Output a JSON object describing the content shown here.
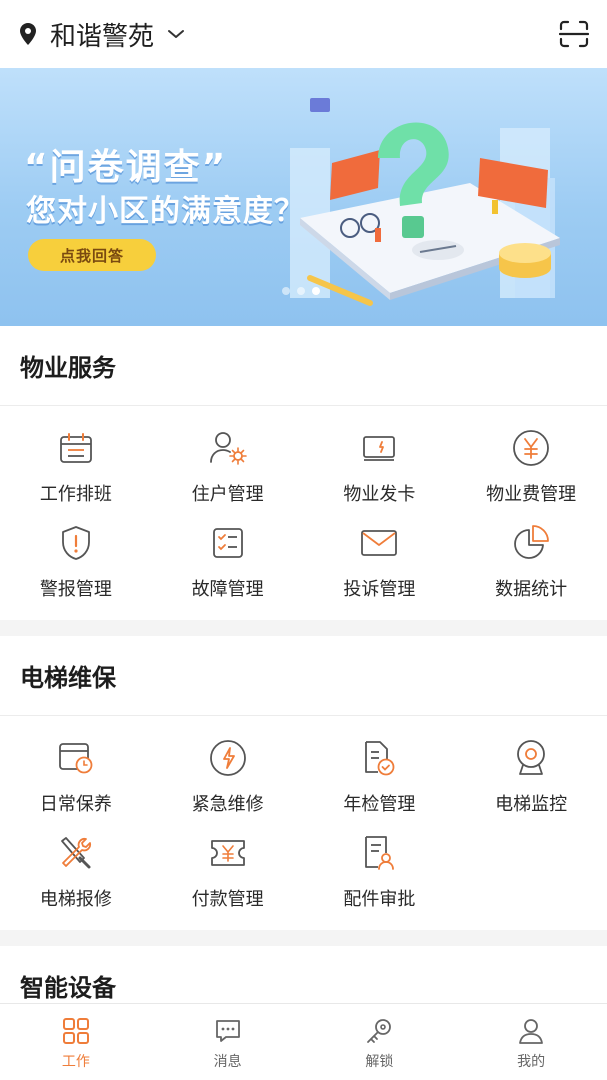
{
  "header": {
    "location": "和谐警苑",
    "location_icon": "map-pin-icon",
    "dropdown_icon": "chevron-down-icon",
    "scan_icon": "scan-icon"
  },
  "banner": {
    "title": "“问卷调查”",
    "subtitle": "您对小区的满意度？",
    "button": "点我回答",
    "dots": [
      false,
      false,
      true
    ]
  },
  "sections": [
    {
      "title": "物业服务",
      "items": [
        {
          "label": "工作排班",
          "icon": "calendar-icon"
        },
        {
          "label": "住户管理",
          "icon": "user-settings-icon"
        },
        {
          "label": "物业发卡",
          "icon": "card-icon"
        },
        {
          "label": "物业费管理",
          "icon": "yuan-icon"
        },
        {
          "label": "警报管理",
          "icon": "shield-alert-icon"
        },
        {
          "label": "故障管理",
          "icon": "checklist-icon"
        },
        {
          "label": "投诉管理",
          "icon": "mail-icon"
        },
        {
          "label": "数据统计",
          "icon": "pie-chart-icon"
        }
      ]
    },
    {
      "title": "电梯维保",
      "items": [
        {
          "label": "日常保养",
          "icon": "calendar-clock-icon"
        },
        {
          "label": "紧急维修",
          "icon": "lightning-icon"
        },
        {
          "label": "年检管理",
          "icon": "document-check-icon"
        },
        {
          "label": "电梯监控",
          "icon": "webcam-icon"
        },
        {
          "label": "电梯报修",
          "icon": "tools-icon"
        },
        {
          "label": "付款管理",
          "icon": "ticket-yuan-icon"
        },
        {
          "label": "配件审批",
          "icon": "document-user-icon"
        }
      ]
    },
    {
      "title": "智能设备",
      "items": []
    }
  ],
  "tabs": [
    {
      "label": "工作",
      "icon": "grid-icon",
      "active": true
    },
    {
      "label": "消息",
      "icon": "message-icon",
      "active": false
    },
    {
      "label": "解锁",
      "icon": "key-icon",
      "active": false
    },
    {
      "label": "我的",
      "icon": "person-icon",
      "active": false
    }
  ],
  "colors": {
    "accent": "#ef7d3a",
    "icon_gray": "#555555",
    "banner_blue": "#9dccf3",
    "button_yellow": "#f7cf3c"
  }
}
